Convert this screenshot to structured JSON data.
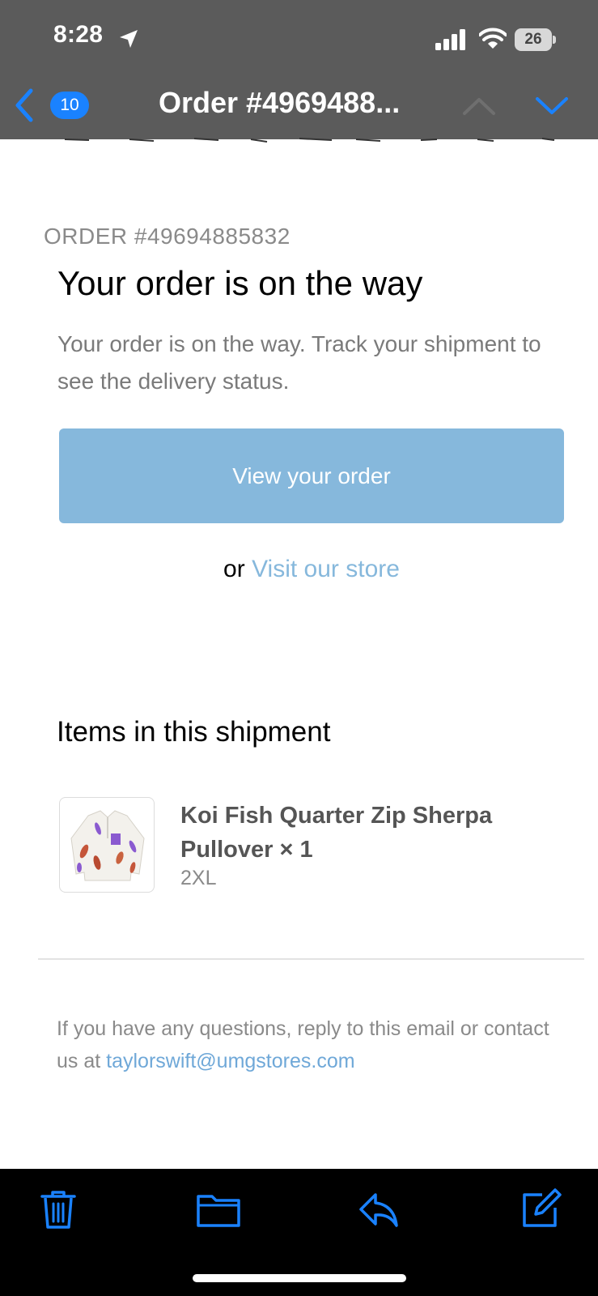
{
  "status_bar": {
    "time": "8:28",
    "battery": "26"
  },
  "nav": {
    "unread_count": "10",
    "title": "Order #4969488..."
  },
  "email": {
    "order_label": "ORDER #49694885832",
    "headline": "Your order is on the way",
    "body": "Your order is on the way. Track your shipment to see the delivery status.",
    "cta_label": "View your order",
    "or_text": "or",
    "store_link": "Visit our store",
    "items_heading": "Items in this shipment",
    "product": {
      "name": "Koi Fish Quarter Zip Sherpa Pullover × 1",
      "variant": "2XL"
    },
    "footer_prefix": "If you have any questions, reply to this email or contact us at",
    "footer_email": "taylorswift@umgstores.com"
  },
  "colors": {
    "header_bg": "#5b5b5b",
    "accent_blue": "#1a82ff",
    "button_bg": "#86b8dc",
    "toolbar_bg": "#000000"
  },
  "icons": {
    "toolbar": [
      "trash-icon",
      "folder-icon",
      "reply-icon",
      "compose-icon"
    ]
  }
}
